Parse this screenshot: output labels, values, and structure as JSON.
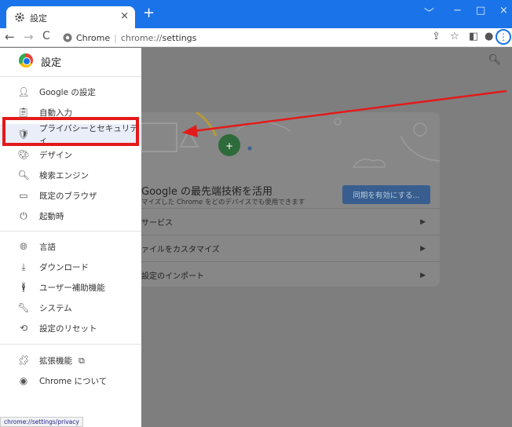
{
  "browser": {
    "tab_title": "設定",
    "tab_close": "×",
    "new_tab": "+",
    "window_controls": [
      "﹀",
      "−",
      "□",
      "×"
    ],
    "omnibox": {
      "site_label": "Chrome",
      "separator": "|",
      "url_scheme": "chrome://",
      "url_path": "settings"
    }
  },
  "sidebar": {
    "title": "設定",
    "items": [
      {
        "label": "Google の設定",
        "icon": "person-icon"
      },
      {
        "label": "自動入力",
        "icon": "clipboard-icon"
      },
      {
        "label": "プライバシーとセキュリティ",
        "icon": "shield-icon",
        "active": true
      },
      {
        "label": "デザイン",
        "icon": "palette-icon"
      },
      {
        "label": "検索エンジン",
        "icon": "search-icon"
      },
      {
        "label": "既定のブラウザ",
        "icon": "browser-window-icon"
      },
      {
        "label": "起動時",
        "icon": "power-icon"
      },
      {
        "label": "言語",
        "icon": "globe-icon"
      },
      {
        "label": "ダウンロード",
        "icon": "download-icon"
      },
      {
        "label": "ユーザー補助機能",
        "icon": "accessibility-icon"
      },
      {
        "label": "システム",
        "icon": "wrench-icon"
      },
      {
        "label": "設定のリセット",
        "icon": "history-icon"
      },
      {
        "label": "拡張機能",
        "icon": "puzzle-icon"
      },
      {
        "label": "Chrome について",
        "icon": "chrome-icon"
      }
    ]
  },
  "main": {
    "card_title": "Google の最先端技術を活用",
    "card_subtitle": "マイズした Chrome をどのデバイスでも使用できます",
    "sync_button": "同期を有効にする...",
    "rows": [
      "サービス",
      "ァイルをカスタマイズ",
      "設定のインポート"
    ]
  },
  "status_bar": "chrome://settings/privacy",
  "colors": {
    "accent": "#1a73e8",
    "annotation": "#e31a1a"
  }
}
